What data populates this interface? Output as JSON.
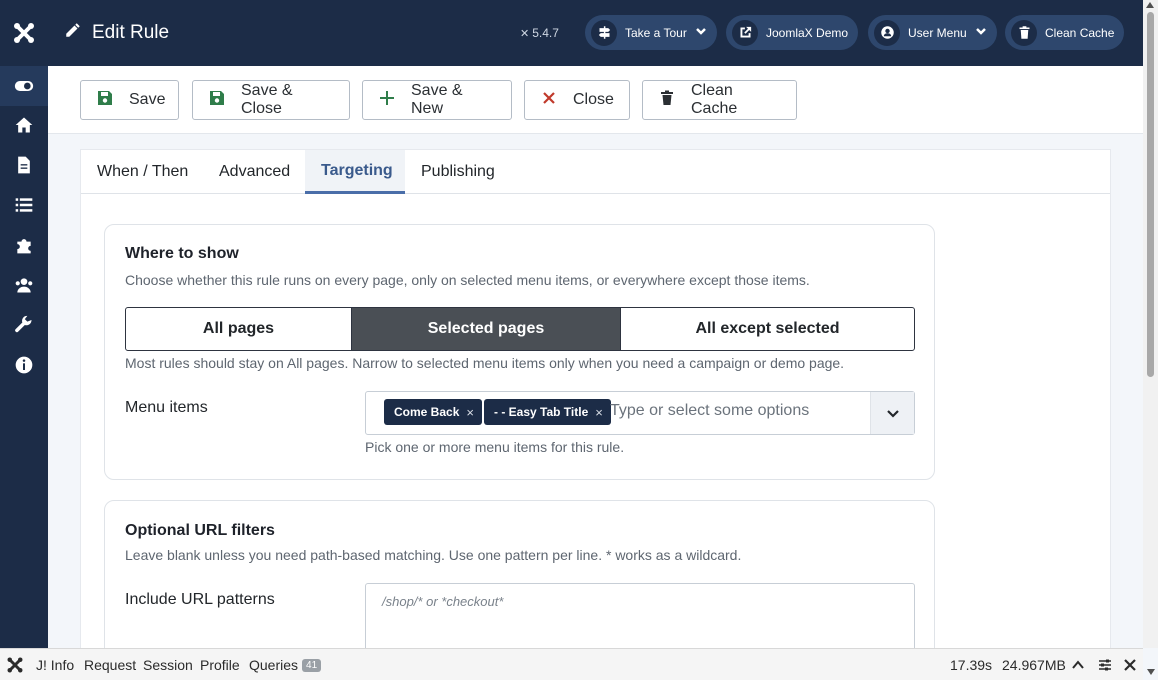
{
  "header": {
    "title": "Edit Rule",
    "version": "5.4.7",
    "buttons": [
      {
        "label": "Take a Tour",
        "icon": "signpost-icon"
      },
      {
        "label": "JoomlaX Demo",
        "icon": "external-link-icon"
      },
      {
        "label": "User Menu",
        "icon": "user-icon"
      },
      {
        "label": "Clean Cache",
        "icon": "trash-icon"
      }
    ]
  },
  "sidebar": {
    "items": [
      {
        "icon": "toggle-icon",
        "active": true
      },
      {
        "icon": "home-icon"
      },
      {
        "icon": "file-icon"
      },
      {
        "icon": "list-icon"
      },
      {
        "icon": "puzzle-icon"
      },
      {
        "icon": "users-icon"
      },
      {
        "icon": "wrench-icon"
      },
      {
        "icon": "info-icon"
      }
    ]
  },
  "toolbar": {
    "save": "Save",
    "save_close": "Save & Close",
    "save_new": "Save & New",
    "close": "Close",
    "clean_cache": "Clean Cache"
  },
  "tabs": [
    {
      "label": "When / Then"
    },
    {
      "label": "Advanced"
    },
    {
      "label": "Targeting",
      "active": true
    },
    {
      "label": "Publishing"
    }
  ],
  "where": {
    "title": "Where to show",
    "desc": "Choose whether this rule runs on every page, only on selected menu items, or everywhere except those items.",
    "options": [
      "All pages",
      "Selected pages",
      "All except selected"
    ],
    "selected": "Selected pages",
    "hint": "Most rules should stay on All pages. Narrow to selected menu items only when you need a campaign or demo page.",
    "menu_label": "Menu items",
    "chips": [
      "Come Back",
      "- - Easy Tab Title"
    ],
    "chip_remove": "×",
    "placeholder": "Type or select some options",
    "menu_hint": "Pick one or more menu items for this rule."
  },
  "url": {
    "title": "Optional URL filters",
    "desc": "Leave blank unless you need path-based matching. Use one pattern per line. * works as a wildcard.",
    "include_label": "Include URL patterns",
    "include_placeholder": "/shop/* or *checkout*"
  },
  "debug": {
    "info": "J! Info",
    "request": "Request",
    "session": "Session",
    "profile": "Profile",
    "queries": "Queries",
    "query_count": "41",
    "time": "17.39s",
    "memory": "24.967MB"
  }
}
